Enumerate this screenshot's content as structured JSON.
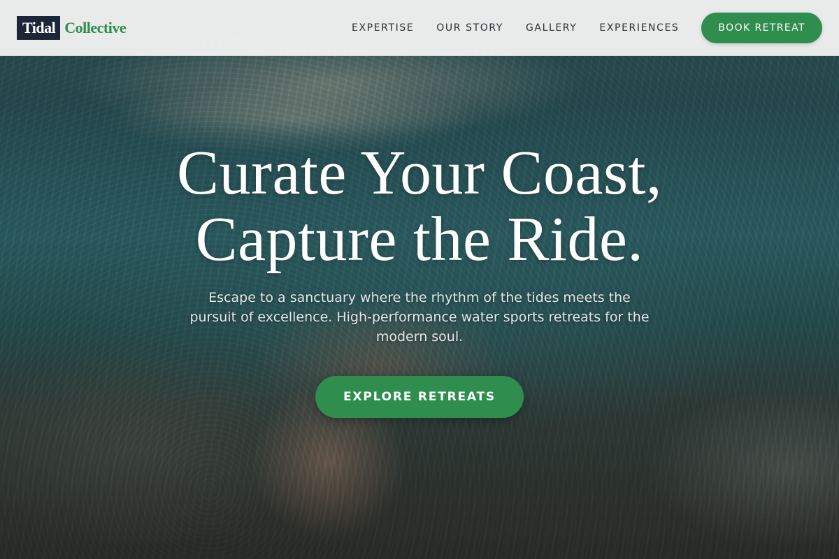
{
  "brand": {
    "logo_box_text": "Tidal",
    "logo_text": "Collective"
  },
  "nav": {
    "items": [
      {
        "label": "EXPERTISE"
      },
      {
        "label": "OUR STORY"
      },
      {
        "label": "GALLERY"
      },
      {
        "label": "EXPERIENCES"
      }
    ],
    "cta_label": "BOOK RETREAT"
  },
  "hero": {
    "title_line1": "Curate Your Coast,",
    "title_line2": "Capture the Ride.",
    "subtitle": "Escape to a sanctuary where the rhythm of the tides meets the pursuit of excellence. High-performance water sports retreats for the modern soul.",
    "cta_label": "EXPLORE RETREATS"
  },
  "colors": {
    "accent_green": "#2f8d4e",
    "logo_navy": "#1c2638",
    "header_bg": "#f8f8f6",
    "nav_text": "#2b2f33"
  }
}
